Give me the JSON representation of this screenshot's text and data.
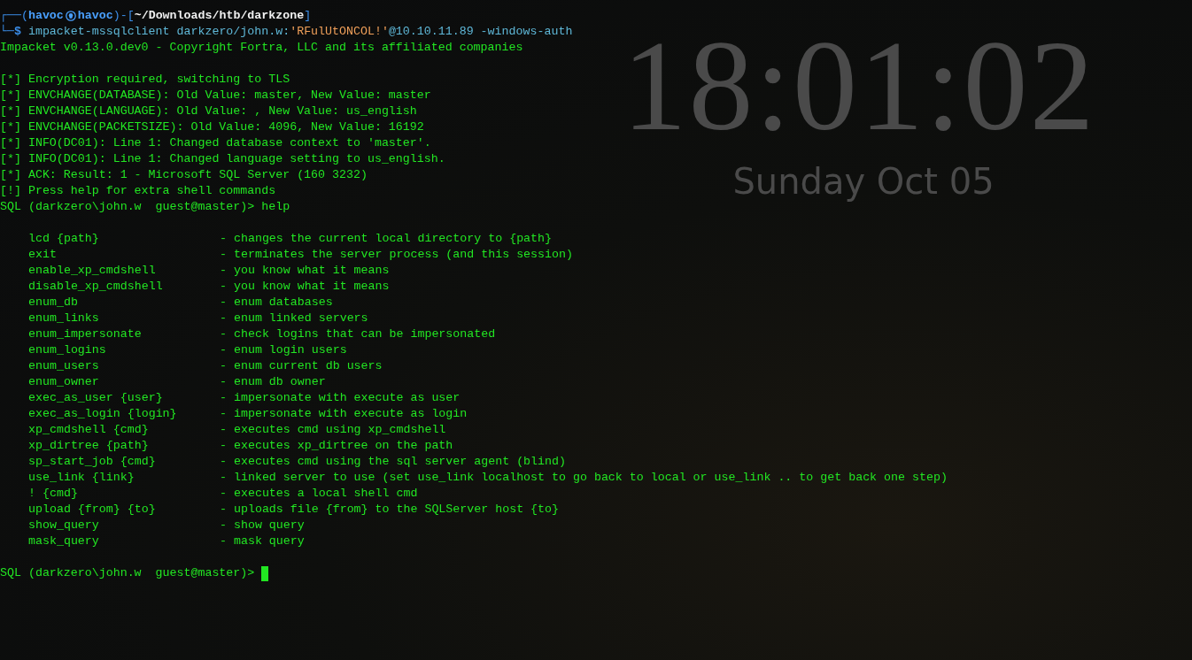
{
  "clock": {
    "time": "18:01:02",
    "date": "Sunday Oct 05"
  },
  "prompt": [
    {
      "kind": "frame",
      "text": "┌──("
    },
    {
      "kind": "user",
      "text": "havoc"
    },
    {
      "kind": "symbol"
    },
    {
      "kind": "user",
      "text": "havoc"
    },
    {
      "kind": "frame",
      "text": ")-["
    },
    {
      "kind": "path",
      "text": "~/Downloads/htb/darkzone"
    },
    {
      "kind": "frame",
      "text": "]"
    }
  ],
  "command": [
    {
      "kind": "frame",
      "text": "└─"
    },
    {
      "kind": "dollar",
      "text": "$"
    },
    {
      "kind": "command",
      "text": " impacket-mssqlclient darkzero/john.w:"
    },
    {
      "kind": "password",
      "text": "'RFulUtONCOL!'"
    },
    {
      "kind": "command",
      "text": "@10.10.11.89 -windows-auth"
    }
  ],
  "banner": "Impacket v0.13.0.dev0 - Copyright Fortra, LLC and its affiliated companies",
  "messages": [
    {
      "marker": "[*]",
      "text": "Encryption required, switching to TLS"
    },
    {
      "marker": "[*]",
      "text": "ENVCHANGE(DATABASE): Old Value: master, New Value: master"
    },
    {
      "marker": "[*]",
      "text": "ENVCHANGE(LANGUAGE): Old Value: , New Value: us_english"
    },
    {
      "marker": "[*]",
      "text": "ENVCHANGE(PACKETSIZE): Old Value: 4096, New Value: 16192"
    },
    {
      "marker": "[*]",
      "text": "INFO(DC01): Line 1: Changed database context to 'master'."
    },
    {
      "marker": "[*]",
      "text": "INFO(DC01): Line 1: Changed language setting to us_english."
    },
    {
      "marker": "[*]",
      "text": "ACK: Result: 1 - Microsoft SQL Server (160 3232)"
    },
    {
      "marker": "[!]",
      "text": "Press help for extra shell commands"
    }
  ],
  "sql_prompt_1": {
    "prompt": "SQL (darkzero\\john.w  guest@master)>",
    "input": "help"
  },
  "help": [
    {
      "command": "lcd {path}",
      "description": "- changes the current local directory to {path}"
    },
    {
      "command": "exit",
      "description": "- terminates the server process (and this session)"
    },
    {
      "command": "enable_xp_cmdshell",
      "description": "- you know what it means"
    },
    {
      "command": "disable_xp_cmdshell",
      "description": "- you know what it means"
    },
    {
      "command": "enum_db",
      "description": "- enum databases"
    },
    {
      "command": "enum_links",
      "description": "- enum linked servers"
    },
    {
      "command": "enum_impersonate",
      "description": "- check logins that can be impersonated"
    },
    {
      "command": "enum_logins",
      "description": "- enum login users"
    },
    {
      "command": "enum_users",
      "description": "- enum current db users"
    },
    {
      "command": "enum_owner",
      "description": "- enum db owner"
    },
    {
      "command": "exec_as_user {user}",
      "description": "- impersonate with execute as user"
    },
    {
      "command": "exec_as_login {login}",
      "description": "- impersonate with execute as login"
    },
    {
      "command": "xp_cmdshell {cmd}",
      "description": "- executes cmd using xp_cmdshell"
    },
    {
      "command": "xp_dirtree {path}",
      "description": "- executes xp_dirtree on the path"
    },
    {
      "command": "sp_start_job {cmd}",
      "description": "- executes cmd using the sql server agent (blind)"
    },
    {
      "command": "use_link {link}",
      "description": "- linked server to use (set use_link localhost to go back to local or use_link .. to get back one step)"
    },
    {
      "command": "! {cmd}",
      "description": "- executes a local shell cmd"
    },
    {
      "command": "upload {from} {to}",
      "description": "- uploads file {from} to the SQLServer host {to}"
    },
    {
      "command": "show_query",
      "description": "- show query"
    },
    {
      "command": "mask_query",
      "description": "- mask query"
    }
  ],
  "sql_prompt_2": {
    "prompt": "SQL (darkzero\\john.w  guest@master)>"
  }
}
